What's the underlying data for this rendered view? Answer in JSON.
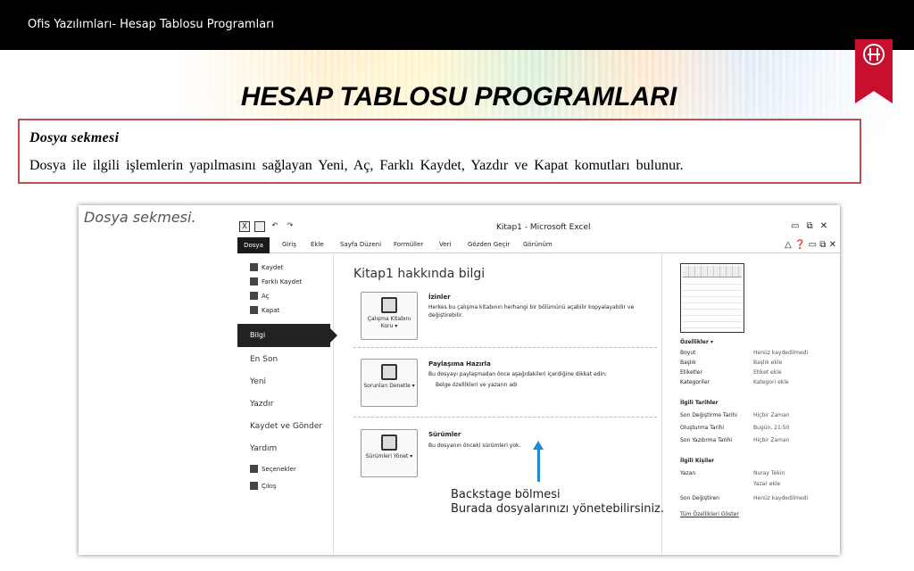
{
  "header": {
    "topbar_text": "Ofis Yazılımları- Hesap Tablosu Programları"
  },
  "slide": {
    "title": "HESAP TABLOSU PROGRAMLARI",
    "box_heading": "Dosya sekmesi",
    "box_text": "Dosya ile ilgili işlemlerin yapılmasını sağlayan Yeni, Aç, Farklı Kaydet, Yazdır ve Kapat komutları bulunur."
  },
  "screenshot": {
    "caption": "Dosya sekmesi.",
    "window_title": "Kitap1 - Microsoft Excel",
    "menu": [
      "Dosya",
      "Giriş",
      "Ekle",
      "Sayfa Düzeni",
      "Formüller",
      "Veri",
      "Gözden Geçir",
      "Görünüm"
    ],
    "left_items_small": [
      "Kaydet",
      "Farklı Kaydet",
      "Aç",
      "Kapat"
    ],
    "left_selected": "Bilgi",
    "left_items_big": [
      "En Son",
      "Yeni",
      "Yazdır",
      "Kaydet ve Gönder",
      "Yardım"
    ],
    "left_items_bottom": [
      "Seçenekler",
      "Çıkış"
    ],
    "center_title": "Kitap1 hakkında bilgi",
    "sections": [
      {
        "button": "Çalışma Kitabını Koru ▾",
        "title": "İzinler",
        "text": "Herkes bu çalışma kitabının herhangi bir bölümünü açabilir kopyalayabilir ve değiştirebilir."
      },
      {
        "button": "Sorunları Denetle ▾",
        "title": "Paylaşıma Hazırla",
        "text": "Bu dosyayı paylaşmadan önce aşağıdakileri içerdiğine dikkat edin:",
        "bullet": "Belge özellikleri ve yazarın adı"
      },
      {
        "button": "Sürümleri Yönet ▾",
        "title": "Sürümler",
        "text": "Bu dosyanın önceki sürümleri yok."
      }
    ],
    "properties": {
      "heading": "Özellikler ▾",
      "rows": [
        [
          "Boyut",
          "Henüz kaydedilmedi"
        ],
        [
          "Başlık",
          "Başlık ekle"
        ],
        [
          "Etiketler",
          "Etiket ekle"
        ],
        [
          "Kategoriler",
          "Kategori ekle"
        ]
      ],
      "dates_heading": "İlgili Tarihler",
      "dates": [
        [
          "Son Değiştirme Tarihi",
          "Hiçbir Zaman"
        ],
        [
          "Oluşturma Tarihi",
          "Bugün, 21:50"
        ],
        [
          "Son Yazdırma Tarihi",
          "Hiçbir Zaman"
        ]
      ],
      "people_heading": "İlgili Kişiler",
      "people": [
        [
          "Yazan",
          "Nuray Tekin"
        ],
        [
          "",
          "Yazar ekle"
        ],
        [
          "Son Değiştiren",
          "Henüz kaydedilmedi"
        ]
      ],
      "link": "Tüm Özellikleri Göster"
    }
  },
  "annotation": {
    "line1": "Backstage bölmesi",
    "line2": "Burada dosyalarınızı yönetebilirsiniz."
  },
  "colors": {
    "box_border": "#c0504d",
    "arrow": "#1f8ad0",
    "logo": "#c8102e"
  }
}
